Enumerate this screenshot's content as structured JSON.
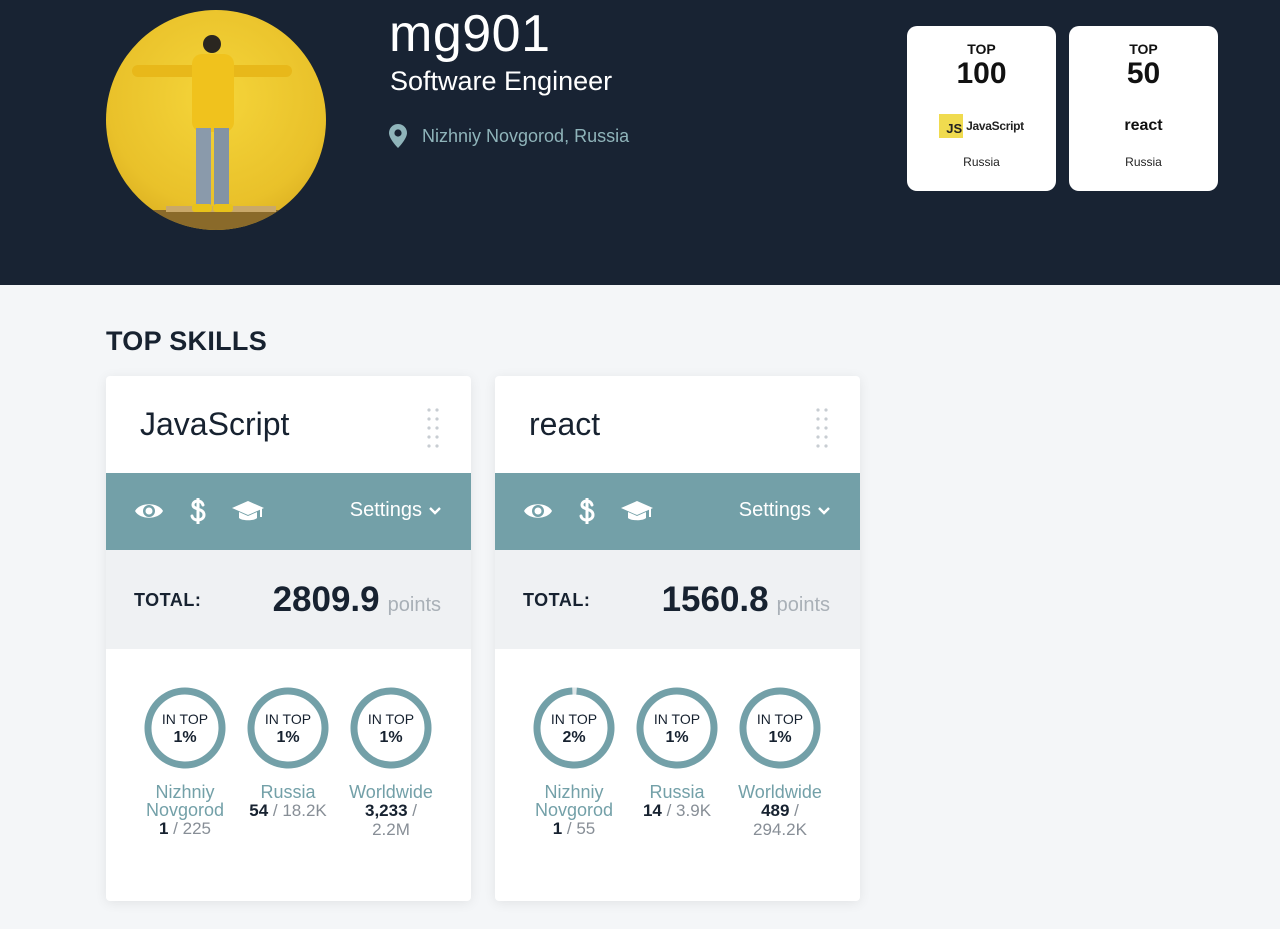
{
  "profile": {
    "username": "mg901",
    "role": "Software Engineer",
    "location": "Nizhniy Novgorod, Russia",
    "icons": {
      "location": "map-pin-icon"
    }
  },
  "badges": [
    {
      "top_label": "TOP",
      "rank": "100",
      "skill": "JavaScript",
      "logo_text": "JS",
      "logo_word": "JavaScript",
      "country": "Russia"
    },
    {
      "top_label": "TOP",
      "rank": "50",
      "skill": "react",
      "country": "Russia"
    }
  ],
  "section_title": "TOP SKILLS",
  "colors": {
    "header_bg": "#182333",
    "accent": "#73a0a8",
    "js_yellow": "#f0db4f",
    "text_dark": "#172230",
    "muted": "#a9b0b7"
  },
  "cards": [
    {
      "title": "JavaScript",
      "settings_label": "Settings",
      "icons": [
        "eye-icon",
        "dollar-icon",
        "graduation-cap-icon",
        "chevron-down-icon",
        "drag-handle-icon"
      ],
      "total_label": "TOTAL:",
      "total_value": "2809.9",
      "total_unit": "points",
      "ranks": [
        {
          "in_top": "IN TOP",
          "percent": "1%",
          "fill": 1.0,
          "name_line1": "Nizhniy",
          "name_line2": "Novgorod",
          "position": "1",
          "of": " / 225",
          "of2": ""
        },
        {
          "in_top": "IN TOP",
          "percent": "1%",
          "fill": 1.0,
          "name_line1": "Russia",
          "name_line2": "",
          "position": "54",
          "of": " / 18.2K",
          "of2": ""
        },
        {
          "in_top": "IN TOP",
          "percent": "1%",
          "fill": 1.0,
          "name_line1": "Worldwide",
          "name_line2": "",
          "position": "3,233",
          "of": " /",
          "of2": "2.2M"
        }
      ]
    },
    {
      "title": "react",
      "settings_label": "Settings",
      "icons": [
        "eye-icon",
        "dollar-icon",
        "graduation-cap-icon",
        "chevron-down-icon",
        "drag-handle-icon"
      ],
      "total_label": "TOTAL:",
      "total_value": "1560.8",
      "total_unit": "points",
      "ranks": [
        {
          "in_top": "IN TOP",
          "percent": "2%",
          "fill": 0.98,
          "name_line1": "Nizhniy",
          "name_line2": "Novgorod",
          "position": "1",
          "of": " / 55",
          "of2": ""
        },
        {
          "in_top": "IN TOP",
          "percent": "1%",
          "fill": 1.0,
          "name_line1": "Russia",
          "name_line2": "",
          "position": "14",
          "of": " / 3.9K",
          "of2": ""
        },
        {
          "in_top": "IN TOP",
          "percent": "1%",
          "fill": 1.0,
          "name_line1": "Worldwide",
          "name_line2": "",
          "position": "489",
          "of": " /",
          "of2": "294.2K"
        }
      ]
    }
  ]
}
